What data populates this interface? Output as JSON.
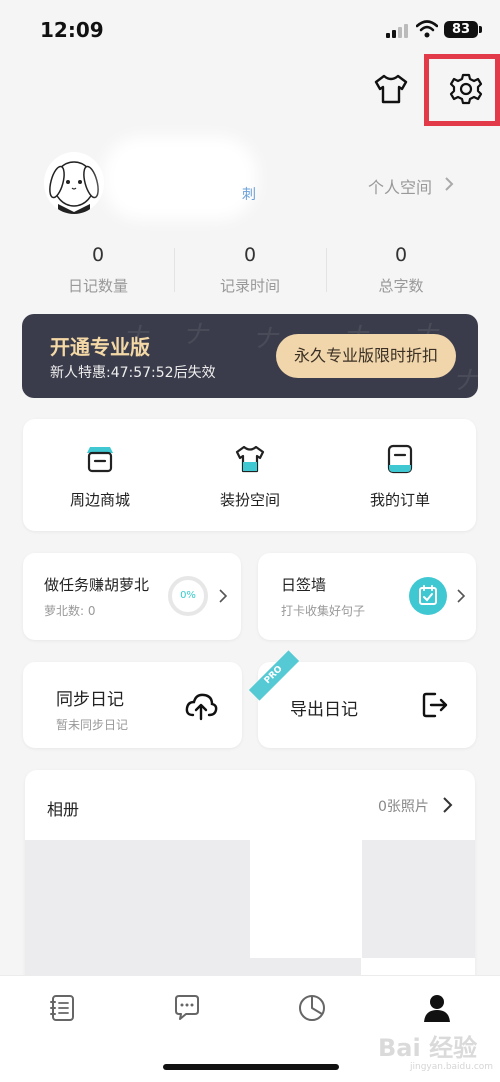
{
  "status_bar": {
    "time": "12:09",
    "battery": "83"
  },
  "profile": {
    "name_fragment": "刺",
    "space_link": "个人空间"
  },
  "stats": [
    {
      "value": "0",
      "label": "日记数量"
    },
    {
      "value": "0",
      "label": "记录时间"
    },
    {
      "value": "0",
      "label": "总字数"
    }
  ],
  "promo": {
    "title": "开通专业版",
    "subtitle": "新人特惠:47:57:52后失效",
    "button": "永久专业版限时折扣"
  },
  "quick_actions": [
    {
      "label": "周边商城",
      "icon": "shop-icon"
    },
    {
      "label": "装扮空间",
      "icon": "shirt-icon"
    },
    {
      "label": "我的订单",
      "icon": "order-icon"
    }
  ],
  "task_card": {
    "title": "做任务赚胡萝北",
    "subtitle": "萝北数: 0",
    "progress": "0%"
  },
  "wall_card": {
    "title": "日签墙",
    "subtitle": "打卡收集好句子"
  },
  "sync_card": {
    "title": "同步日记",
    "subtitle": "暂未同步日记"
  },
  "export_card": {
    "title": "导出日记",
    "badge": "PRO"
  },
  "album": {
    "title": "相册",
    "count": "0张照片"
  },
  "tabs": [
    "diary-tab",
    "messages-tab",
    "stats-tab",
    "profile-tab"
  ],
  "watermark": {
    "main": "Bai 经验",
    "sub": "jingyan.baidu.com"
  },
  "colors": {
    "accent": "#3fc8d2",
    "highlight": "#e33a4a",
    "banner": "#3b3c4b",
    "gold": "#f1d6ac"
  }
}
